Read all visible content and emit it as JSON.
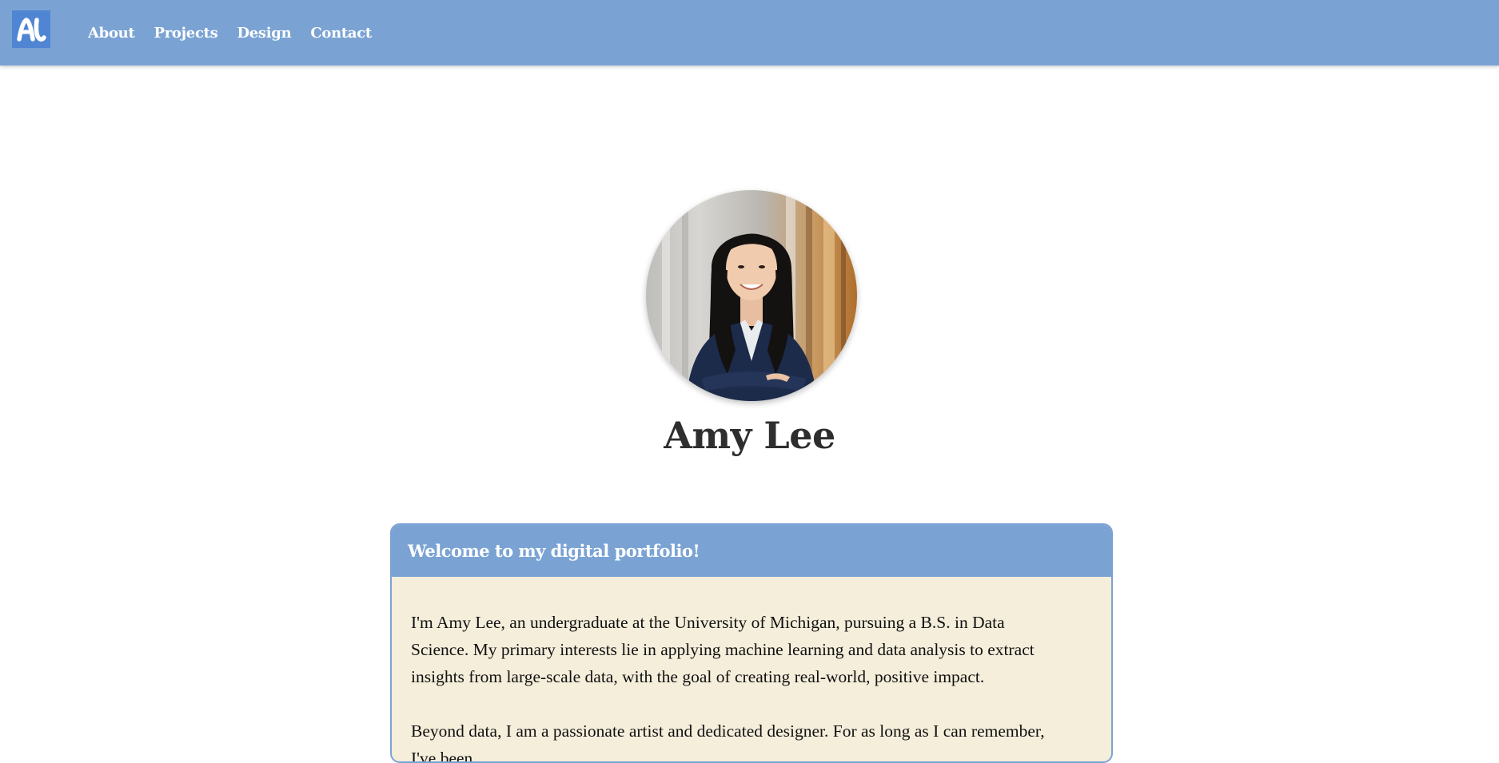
{
  "nav": {
    "logo_text": "AL",
    "links": [
      {
        "label": "About"
      },
      {
        "label": "Projects"
      },
      {
        "label": "Design"
      },
      {
        "label": "Contact"
      }
    ]
  },
  "profile": {
    "name": "Amy Lee"
  },
  "intro_card": {
    "title": "Welcome to my digital portfolio!",
    "paragraphs": [
      "I'm Amy Lee, an undergraduate at the University of Michigan, pursuing a B.S. in Data Science. My primary interests lie in applying machine learning and data analysis to extract insights from large-scale data, with the goal of creating real-world, positive impact.",
      "Beyond data, I am a passionate artist and dedicated designer. For as long as I can remember, I've been"
    ]
  },
  "colors": {
    "nav_bg": "#7aa3d4",
    "logo_bg": "#4f85d3",
    "card_bg": "#f5eedb",
    "name_text": "#2e2e2e"
  }
}
